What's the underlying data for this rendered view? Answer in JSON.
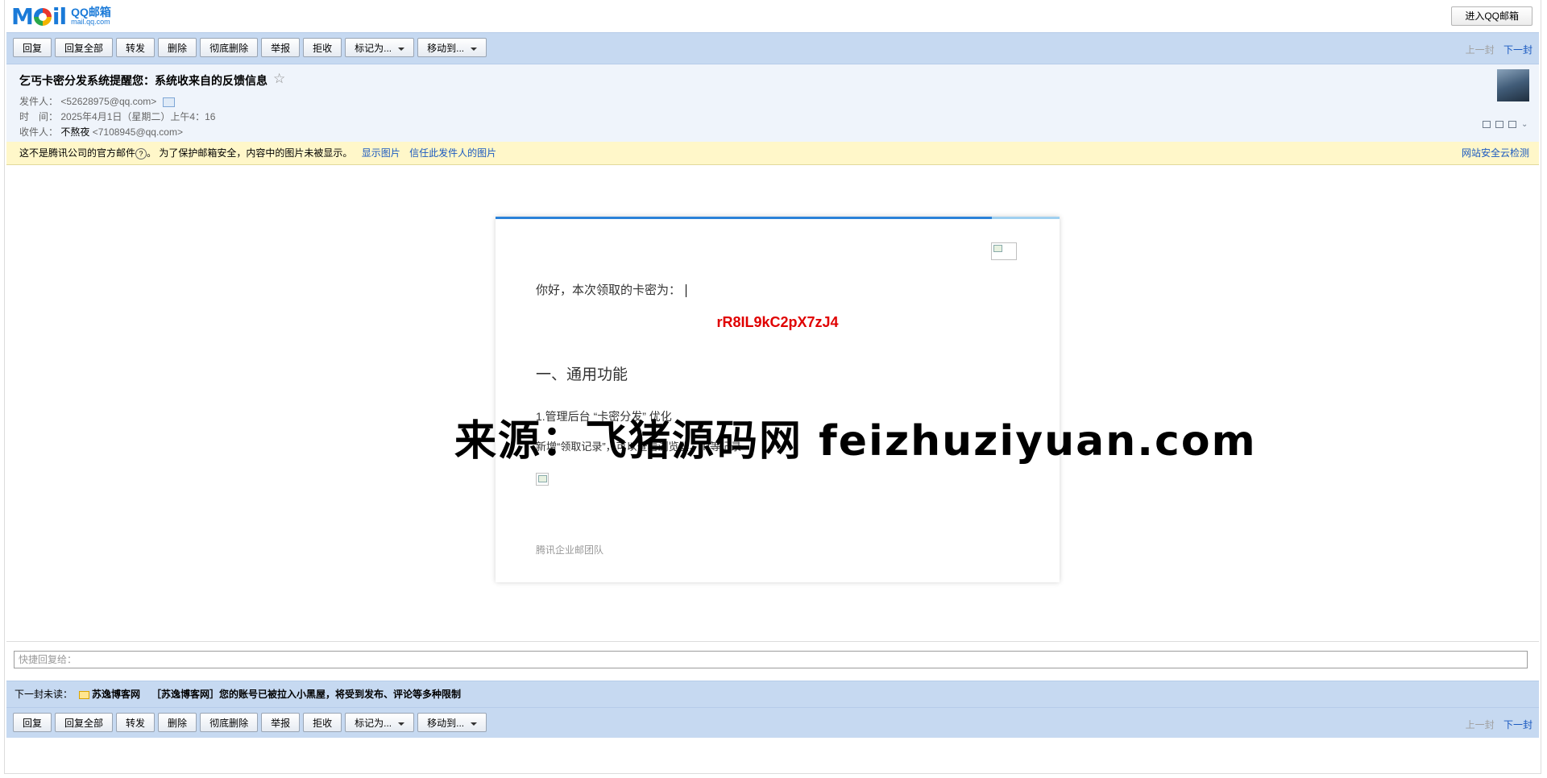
{
  "brand": {
    "logo_main": "M",
    "logo_cn": "QQ邮箱",
    "logo_domain": "mail.qq.com"
  },
  "header_button": "进入QQ邮箱",
  "toolbar": {
    "buttons": [
      "回复",
      "回复全部",
      "转发",
      "删除",
      "彻底删除",
      "举报",
      "拒收",
      "标记为...",
      "移动到..."
    ],
    "prev": "上一封",
    "next": "下一封"
  },
  "mail": {
    "subject": "乞丐卡密分发系统提醒您：系统收来自的反馈信息",
    "sender_label": "发件人：",
    "sender_value": "<52628975@qq.com>",
    "time_label": "时　间：",
    "time_value": "2025年4月1日（星期二）上午4：16",
    "recipient_label": "收件人：",
    "recipient_name": "不熬夜",
    "recipient_addr": "<7108945@qq.com>"
  },
  "warning": {
    "text": "这不是腾讯公司的官方邮件",
    "help": "?",
    "text2": "。 为了保护邮箱安全，内容中的图片未被显示。",
    "show_images": "显示图片",
    "trust_sender": "信任此发件人的图片",
    "security_check": "网站安全云检测"
  },
  "body": {
    "greeting": "你好，本次领取的卡密为：",
    "code": "rR8IL9kC2pX7zJ4",
    "section_title": "一、通用功能",
    "item1": "1.管理后台 “卡密分发” 优化",
    "item2": "新增“领取记录”，可以查看浏览器、IP等记录",
    "team": "腾讯企业邮团队",
    "progress": 0.88
  },
  "watermark": "来源：飞猪源码网 feizhuziyuan.com",
  "quick_reply_placeholder": "快捷回复给：",
  "next_unread": {
    "label": "下一封未读：",
    "from": "苏逸博客网",
    "subject": "［苏逸博客网］您的账号已被拉入小黑屋，将受到发布、评论等多种限制"
  }
}
